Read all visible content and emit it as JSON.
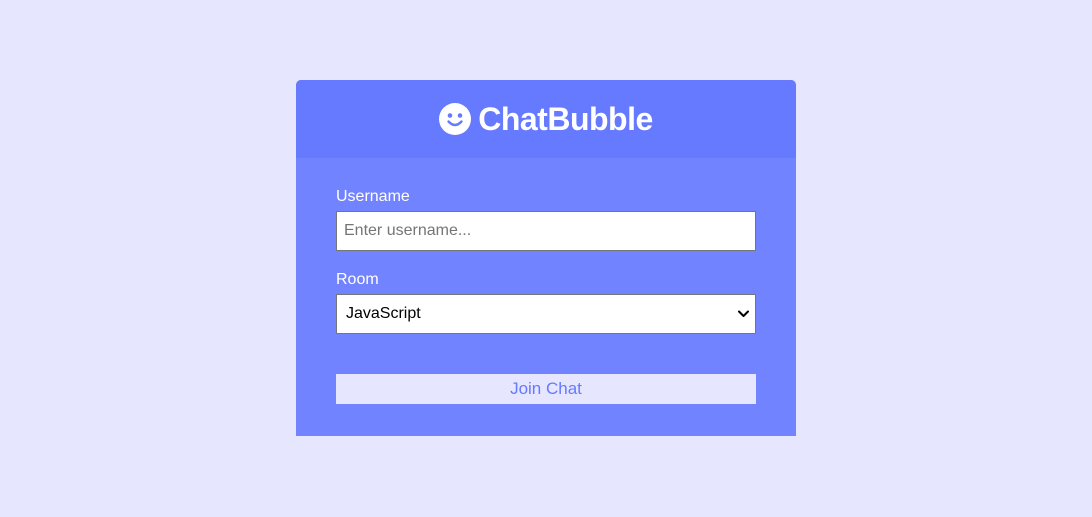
{
  "header": {
    "title": "ChatBubble",
    "icon": "smile-icon"
  },
  "form": {
    "username": {
      "label": "Username",
      "placeholder": "Enter username...",
      "value": ""
    },
    "room": {
      "label": "Room",
      "selected": "JavaScript",
      "icon": "chevron-down-icon"
    },
    "submit_label": "Join Chat"
  },
  "colors": {
    "page_background": "#e6e7fe",
    "header_background": "#667aff",
    "body_background": "#7283ff",
    "button_background": "#e6e7fe",
    "button_text": "#667aff"
  }
}
